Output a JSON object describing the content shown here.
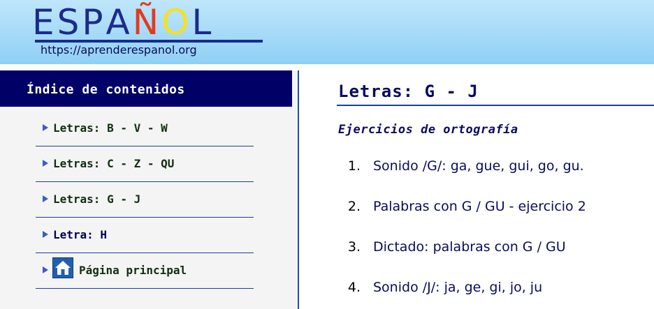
{
  "header": {
    "logo_letters": [
      "E",
      "S",
      "P",
      "A",
      "Ñ",
      "O",
      "L"
    ],
    "logo_colors": [
      "#1a2b8c",
      "#1a2b8c",
      "#1a2b8c",
      "#1a2b8c",
      "#e23b1b",
      "#f7e11a",
      "#1a2b8c"
    ],
    "logo_url": "https://aprenderespanol.org"
  },
  "sidebar": {
    "title": "Índice de contenidos",
    "items": [
      {
        "label": "Letras: B - V - W"
      },
      {
        "label": "Letras: C - Z - QU"
      },
      {
        "label": "Letras: G - J"
      },
      {
        "label": "Letra: H"
      },
      {
        "label": "Página principal",
        "icon": "home-icon"
      }
    ]
  },
  "main": {
    "title": "Letras: G - J",
    "section_heading": "Ejercicios de ortografía",
    "exercises": [
      {
        "number": "1.",
        "label": "Sonido /G/: ga, gue, gui, go, gu."
      },
      {
        "number": "2.",
        "label": "Palabras con G / GU - ejercicio 2"
      },
      {
        "number": "3.",
        "label": "Dictado: palabras con G / GU"
      },
      {
        "number": "4.",
        "label": "Sonido /J/: ja, ge, gi, jo, ju"
      }
    ]
  },
  "colors": {
    "header_gradient_top": "#bfe6fb",
    "header_gradient_bottom": "#8fd0f5",
    "sidebar_title_bg": "#000066",
    "accent_blue": "#1a3fa0",
    "text_navy": "#0a0a60"
  }
}
